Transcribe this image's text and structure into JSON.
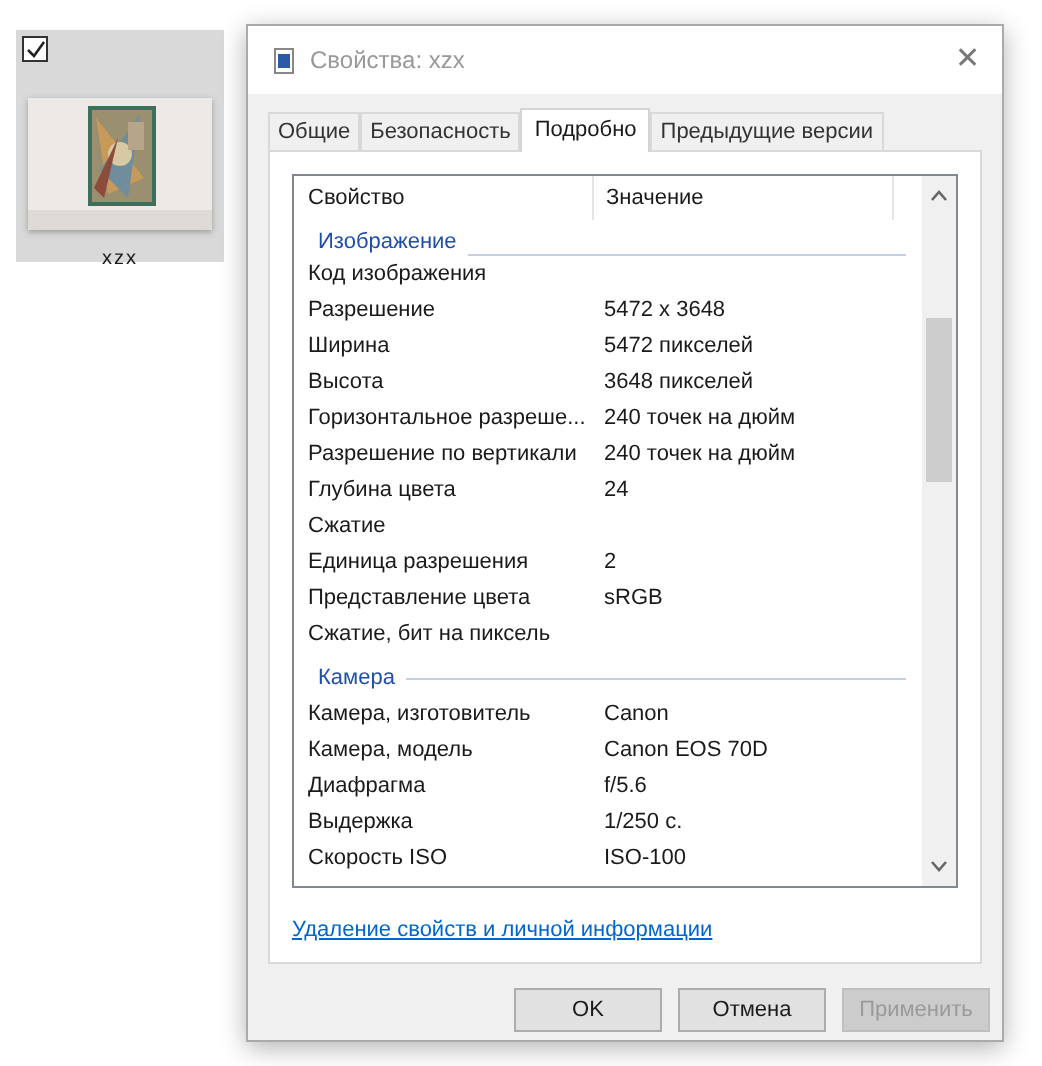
{
  "file_tile": {
    "checked": true,
    "name": "xzx",
    "selected": true
  },
  "window": {
    "title": "Свойства: xzx",
    "close": "✕"
  },
  "tabs": [
    {
      "label": "Общие",
      "selected": false
    },
    {
      "label": "Безопасность",
      "selected": false
    },
    {
      "label": "Подробно",
      "selected": true
    },
    {
      "label": "Предыдущие версии",
      "selected": false
    }
  ],
  "table": {
    "columns": [
      "Свойство",
      "Значение"
    ],
    "rows": [
      {
        "kind": "group",
        "label": "Изображение"
      },
      {
        "kind": "row",
        "property": "Код изображения",
        "value": ""
      },
      {
        "kind": "row",
        "property": "Разрешение",
        "value": "5472 x 3648"
      },
      {
        "kind": "row",
        "property": "Ширина",
        "value": "5472 пикселей"
      },
      {
        "kind": "row",
        "property": "Высота",
        "value": "3648 пикселей"
      },
      {
        "kind": "row",
        "property": "Горизонтальное разреше...",
        "value": "240 точек на дюйм"
      },
      {
        "kind": "row",
        "property": "Разрешение по вертикали",
        "value": "240 точек на дюйм"
      },
      {
        "kind": "row",
        "property": "Глубина цвета",
        "value": "24"
      },
      {
        "kind": "row",
        "property": "Сжатие",
        "value": ""
      },
      {
        "kind": "row",
        "property": "Единица разрешения",
        "value": "2"
      },
      {
        "kind": "row",
        "property": "Представление цвета",
        "value": "sRGB"
      },
      {
        "kind": "row",
        "property": "Сжатие, бит на пиксель",
        "value": ""
      },
      {
        "kind": "group",
        "label": "Камера"
      },
      {
        "kind": "row",
        "property": "Камера, изготовитель",
        "value": "Canon"
      },
      {
        "kind": "row",
        "property": "Камера, модель",
        "value": "Canon EOS 70D"
      },
      {
        "kind": "row",
        "property": "Диафрагма",
        "value": "f/5.6"
      },
      {
        "kind": "row",
        "property": "Выдержка",
        "value": "1/250 с."
      },
      {
        "kind": "row",
        "property": "Скорость ISO",
        "value": "ISO-100"
      }
    ]
  },
  "link": "Удаление свойств и личной информации",
  "buttons": [
    {
      "label": "OK",
      "disabled": false
    },
    {
      "label": "Отмена",
      "disabled": false
    },
    {
      "label": "Применить",
      "disabled": true
    }
  ]
}
